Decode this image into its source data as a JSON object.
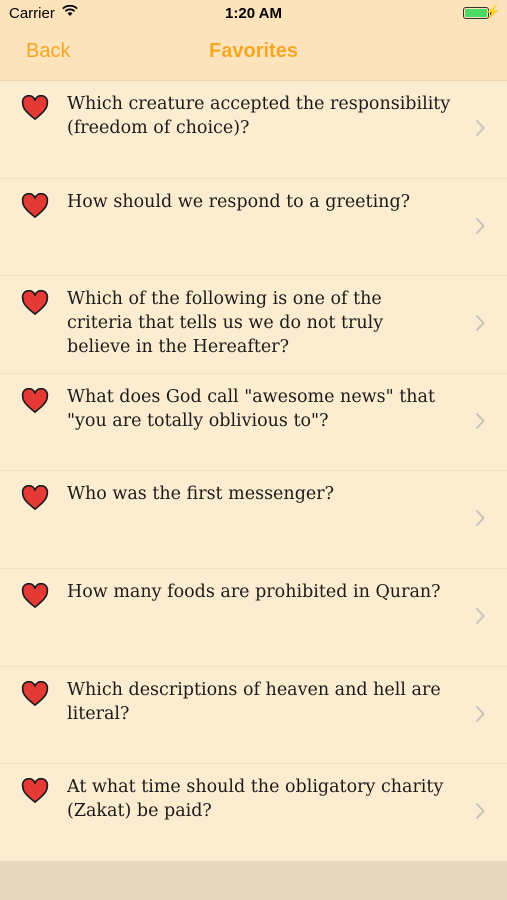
{
  "status": {
    "carrier": "Carrier",
    "time": "1:20 AM"
  },
  "nav": {
    "back_label": "Back",
    "title": "Favorites"
  },
  "colors": {
    "accent": "#f5a623",
    "background": "#fdedd0",
    "heart": "#e53935"
  },
  "items": [
    {
      "question": "Which creature accepted the responsibility (freedom of choice)?"
    },
    {
      "question": "How should we respond to a greeting?"
    },
    {
      "question": "Which of the following is one of the criteria that tells us we do not truly believe in the Hereafter?"
    },
    {
      "question": "What does God call \"awesome news\" that \"you are totally oblivious to\"?"
    },
    {
      "question": "Who was the first messenger?"
    },
    {
      "question": "How many foods are prohibited in Quran?"
    },
    {
      "question": "Which descriptions of heaven and hell are literal?"
    },
    {
      "question": "At what time should the obligatory charity (Zakat) be paid?"
    }
  ]
}
